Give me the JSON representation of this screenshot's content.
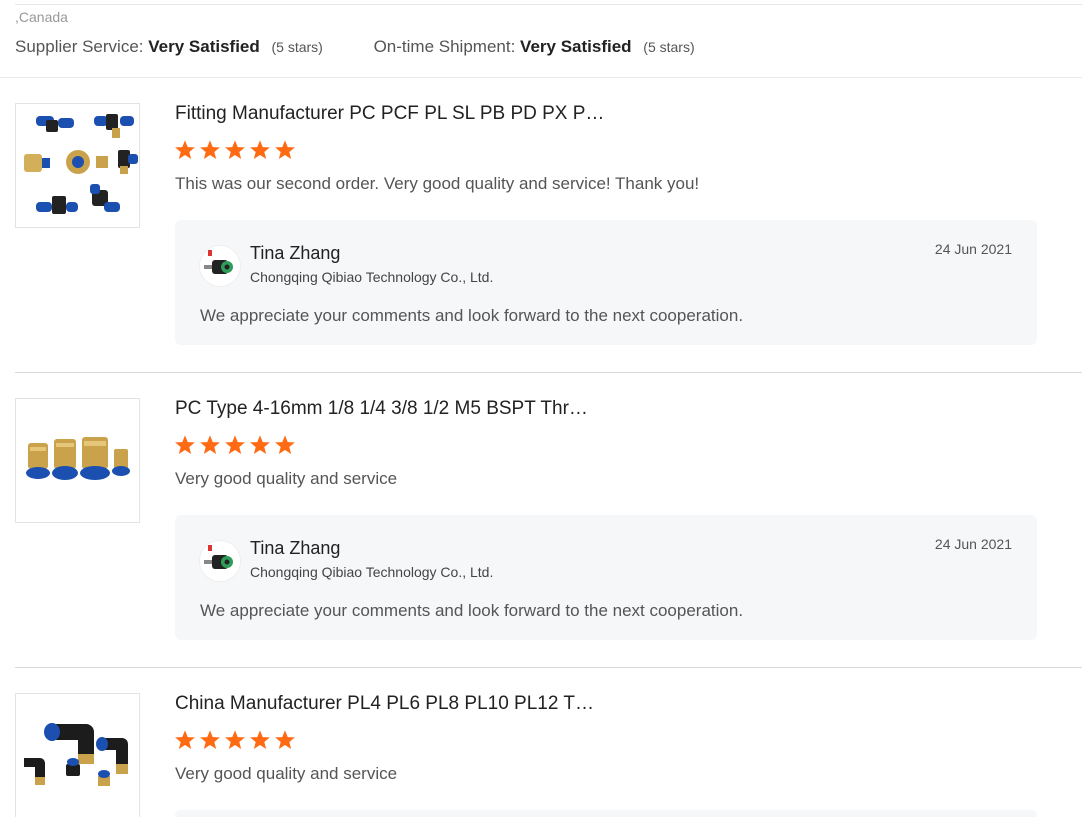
{
  "summary": {
    "location": ",Canada",
    "supplier_service_label": "Supplier Service:",
    "supplier_service_value": "Very Satisfied",
    "supplier_service_stars": "(5 stars)",
    "shipment_label": "On-time Shipment:",
    "shipment_value": "Very Satisfied",
    "shipment_stars": "(5 stars)"
  },
  "colors": {
    "star": "#ff6a13",
    "reply_background": "#f6f7f9"
  },
  "reviews": [
    {
      "title": "Fitting Manufacturer PC PCF PL SL PB PD PX P…",
      "rating": 5,
      "comment": "This was our second order.  Very good quality and service!  Thank you!",
      "thumbnail_icon": "pneumatic-fittings-assortment",
      "reply": {
        "name": "Tina Zhang",
        "company": "Chongqing Qibiao Technology Co., Ltd.",
        "date": "24 Jun 2021",
        "text": "We appreciate your comments and look forward to the next cooperation."
      }
    },
    {
      "title": "PC Type 4-16mm 1/8 1/4 3/8 1/2 M5 BSPT Thr…",
      "rating": 5,
      "comment": "Very good quality and service",
      "thumbnail_icon": "brass-push-in-connectors",
      "reply": {
        "name": "Tina Zhang",
        "company": "Chongqing Qibiao Technology Co., Ltd.",
        "date": "24 Jun 2021",
        "text": "We appreciate your comments and look forward to the next cooperation."
      }
    },
    {
      "title": "China Manufacturer PL4 PL6 PL8 PL10 PL12 T…",
      "rating": 5,
      "comment": "Very good quality and service",
      "thumbnail_icon": "elbow-fittings"
    }
  ]
}
